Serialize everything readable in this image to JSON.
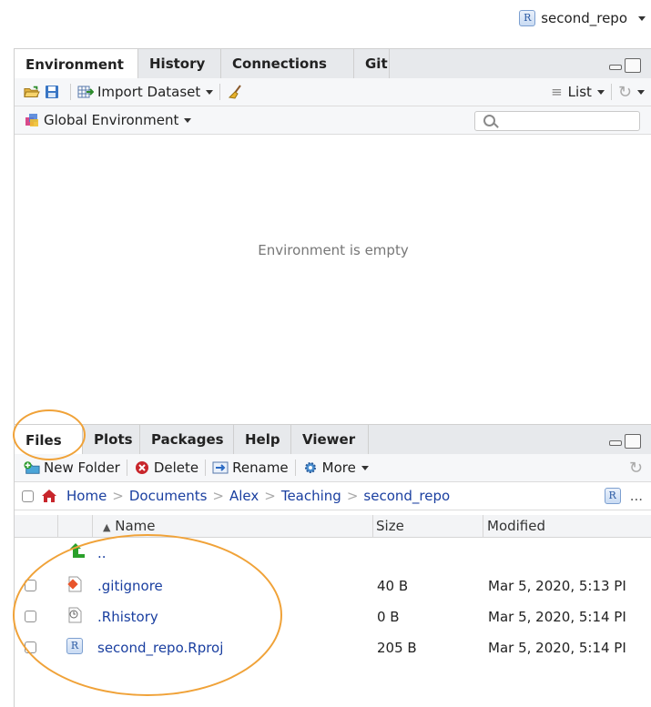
{
  "project": {
    "name": "second_repo",
    "icon": "r-project-icon"
  },
  "env_pane": {
    "tabs": [
      "Environment",
      "History",
      "Connections",
      "Git"
    ],
    "active_tab": "Environment",
    "toolbar": {
      "import_label": "Import Dataset",
      "list_label": "List"
    },
    "scope": "Global Environment",
    "search_placeholder": "",
    "empty_message": "Environment is empty"
  },
  "files_pane": {
    "tabs": [
      "Files",
      "Plots",
      "Packages",
      "Help",
      "Viewer"
    ],
    "active_tab": "Files",
    "toolbar": {
      "new_folder": "New Folder",
      "delete": "Delete",
      "rename": "Rename",
      "more": "More"
    },
    "breadcrumb": [
      "Home",
      "Documents",
      "Alex",
      "Teaching",
      "second_repo"
    ],
    "breadcrumb_more": "...",
    "columns": {
      "name": "Name",
      "size": "Size",
      "modified": "Modified",
      "sort_indicator": "▲"
    },
    "parent_label": "..",
    "files": [
      {
        "name": ".gitignore",
        "size": "40 B",
        "modified": "Mar 5, 2020, 5:13 PI",
        "icon": "git-file-icon"
      },
      {
        "name": ".Rhistory",
        "size": "0 B",
        "modified": "Mar 5, 2020, 5:14 PI",
        "icon": "history-file-icon"
      },
      {
        "name": "second_repo.Rproj",
        "size": "205 B",
        "modified": "Mar 5, 2020, 5:14 PI",
        "icon": "r-project-file-icon"
      }
    ]
  },
  "colors": {
    "annotation": "#f0a238",
    "link": "#1a3fa0",
    "tab_bg": "#e7e9ec"
  }
}
